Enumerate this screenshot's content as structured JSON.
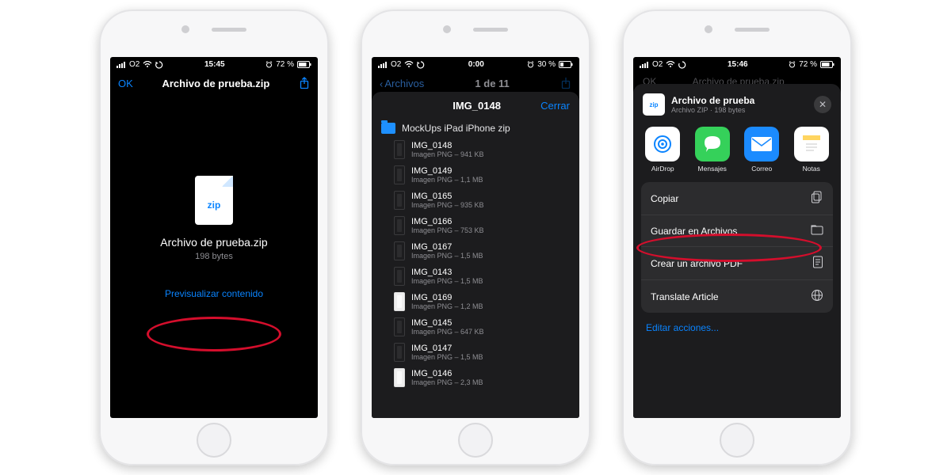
{
  "phone1": {
    "status": {
      "carrier": "O2",
      "time": "15:45",
      "battery": "72 %"
    },
    "nav": {
      "ok": "OK",
      "title": "Archivo de prueba.zip"
    },
    "doc": {
      "ext": "zip",
      "name": "Archivo de prueba.zip",
      "size": "198 bytes",
      "preview": "Previsualizar contenido"
    }
  },
  "phone2": {
    "status": {
      "carrier": "O2",
      "time": "0:00",
      "battery": "30 %"
    },
    "nav": {
      "back": "Archivos",
      "counter": "1 de 11"
    },
    "sheet": {
      "title": "IMG_0148",
      "close": "Cerrar",
      "folder": "MockUps iPad iPhone zip"
    },
    "files": [
      {
        "name": "IMG_0148",
        "sub": "Imagen PNG – 941 KB",
        "light": false
      },
      {
        "name": "IMG_0149",
        "sub": "Imagen PNG – 1,1 MB",
        "light": false
      },
      {
        "name": "IMG_0165",
        "sub": "Imagen PNG – 935 KB",
        "light": false
      },
      {
        "name": "IMG_0166",
        "sub": "Imagen PNG – 753 KB",
        "light": false
      },
      {
        "name": "IMG_0167",
        "sub": "Imagen PNG – 1,5 MB",
        "light": false
      },
      {
        "name": "IMG_0143",
        "sub": "Imagen PNG – 1,5 MB",
        "light": false
      },
      {
        "name": "IMG_0169",
        "sub": "Imagen PNG – 1,2 MB",
        "light": true
      },
      {
        "name": "IMG_0145",
        "sub": "Imagen PNG – 647 KB",
        "light": false
      },
      {
        "name": "IMG_0147",
        "sub": "Imagen PNG – 1,5 MB",
        "light": false
      },
      {
        "name": "IMG_0146",
        "sub": "Imagen PNG – 2,3 MB",
        "light": true
      }
    ]
  },
  "phone3": {
    "status": {
      "carrier": "O2",
      "time": "15:46",
      "battery": "72 %"
    },
    "dimnav": {
      "ok": "OK",
      "title": "Archivo de prueba.zip"
    },
    "header": {
      "name": "Archivo de prueba",
      "detail": "Archivo ZIP · 198 bytes"
    },
    "apps": [
      {
        "key": "airdrop",
        "label": "AirDrop"
      },
      {
        "key": "messages",
        "label": "Mensajes"
      },
      {
        "key": "mail",
        "label": "Correo"
      },
      {
        "key": "notes",
        "label": "Notas"
      }
    ],
    "actions": [
      {
        "label": "Copiar",
        "icon": "copy-icon"
      },
      {
        "label": "Guardar en Archivos",
        "icon": "folder-icon",
        "highlight": true
      },
      {
        "label": "Crear un archivo PDF",
        "icon": "pdf-icon"
      },
      {
        "label": "Translate Article",
        "icon": "globe-icon"
      }
    ],
    "edit": "Editar acciones..."
  }
}
